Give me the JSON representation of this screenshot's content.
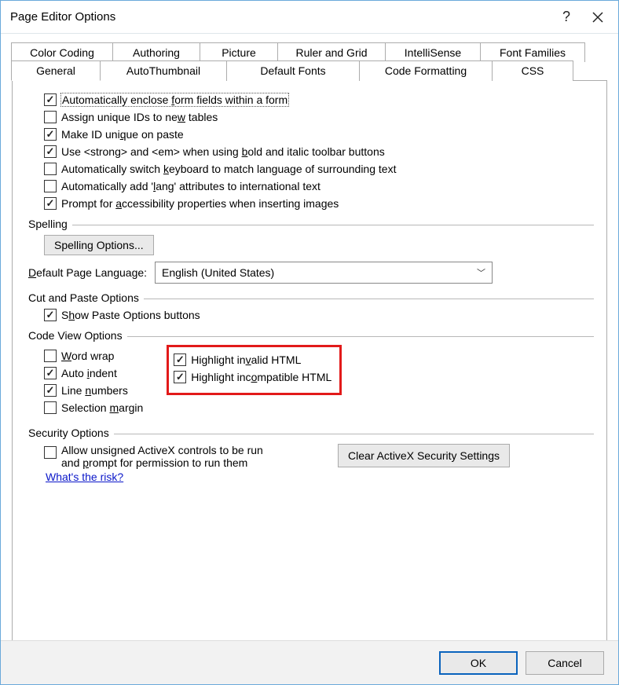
{
  "window": {
    "title": "Page Editor Options"
  },
  "tabs_top": {
    "t0": "Color Coding",
    "t1": "Authoring",
    "t2": "Picture",
    "t3": "Ruler and Grid",
    "t4": "IntelliSense",
    "t5": "Font Families"
  },
  "tabs_bottom": {
    "b0": "General",
    "b1": "AutoThumbnail",
    "b2": "Default Fonts",
    "b3": "Code Formatting",
    "b4": "CSS"
  },
  "general_checks": {
    "c0": {
      "checked": true,
      "pre": "Automatically enclose ",
      "u": "f",
      "post": "orm fields within a form",
      "focused": true
    },
    "c1": {
      "checked": false,
      "pre": "Assign unique IDs to ne",
      "u": "w",
      "post": " tables"
    },
    "c2": {
      "checked": true,
      "pre": "Make ID uni",
      "u": "q",
      "post": "ue on paste"
    },
    "c3": {
      "checked": true,
      "pre": "Use <strong> and <em> when using ",
      "u": "b",
      "post": "old and italic toolbar buttons"
    },
    "c4": {
      "checked": false,
      "pre": "Automatically switch ",
      "u": "k",
      "post": "eyboard to match language of surrounding text"
    },
    "c5": {
      "checked": false,
      "pre": "Automatically add '",
      "u": "l",
      "post": "ang' attributes to international text"
    },
    "c6": {
      "checked": true,
      "pre": "Prompt for ",
      "u": "a",
      "post": "ccessibility properties when inserting images"
    }
  },
  "spelling": {
    "title": "Spelling",
    "button_pre": "",
    "button_u": "S",
    "button_post": "pelling Options...",
    "lang_label_pre": "",
    "lang_label_u": "D",
    "lang_label_post": "efault Page Language:",
    "lang_value": "English (United States)"
  },
  "cutpaste": {
    "title": "Cut and Paste Options",
    "show": {
      "checked": true,
      "pre": "S",
      "u": "h",
      "post": "ow Paste Options buttons"
    }
  },
  "codeview": {
    "title": "Code View Options",
    "left": {
      "wrap": {
        "checked": false,
        "pre": "",
        "u": "W",
        "post": "ord wrap"
      },
      "indent": {
        "checked": true,
        "pre": "Auto ",
        "u": "i",
        "post": "ndent"
      },
      "lines": {
        "checked": true,
        "pre": "Line ",
        "u": "n",
        "post": "umbers"
      },
      "margin": {
        "checked": false,
        "pre": "Selection ",
        "u": "m",
        "post": "argin"
      }
    },
    "right": {
      "invalid": {
        "checked": true,
        "pre": "Highlight in",
        "u": "v",
        "post": "alid HTML"
      },
      "incompat": {
        "checked": true,
        "pre": "Highlight inc",
        "u": "o",
        "post": "mpatible HTML"
      }
    }
  },
  "security": {
    "title": "Security Options",
    "allow": {
      "checked": false,
      "line1": "Allow unsigned ActiveX controls to be run",
      "line2_pre": "and ",
      "line2_u": "p",
      "line2_post": "rompt for permission to run them"
    },
    "clear_pre": "Cl",
    "clear_u": "e",
    "clear_post": "ar ActiveX Security Settings",
    "risk": "What's the risk?"
  },
  "footer": {
    "ok": "OK",
    "cancel": "Cancel"
  }
}
